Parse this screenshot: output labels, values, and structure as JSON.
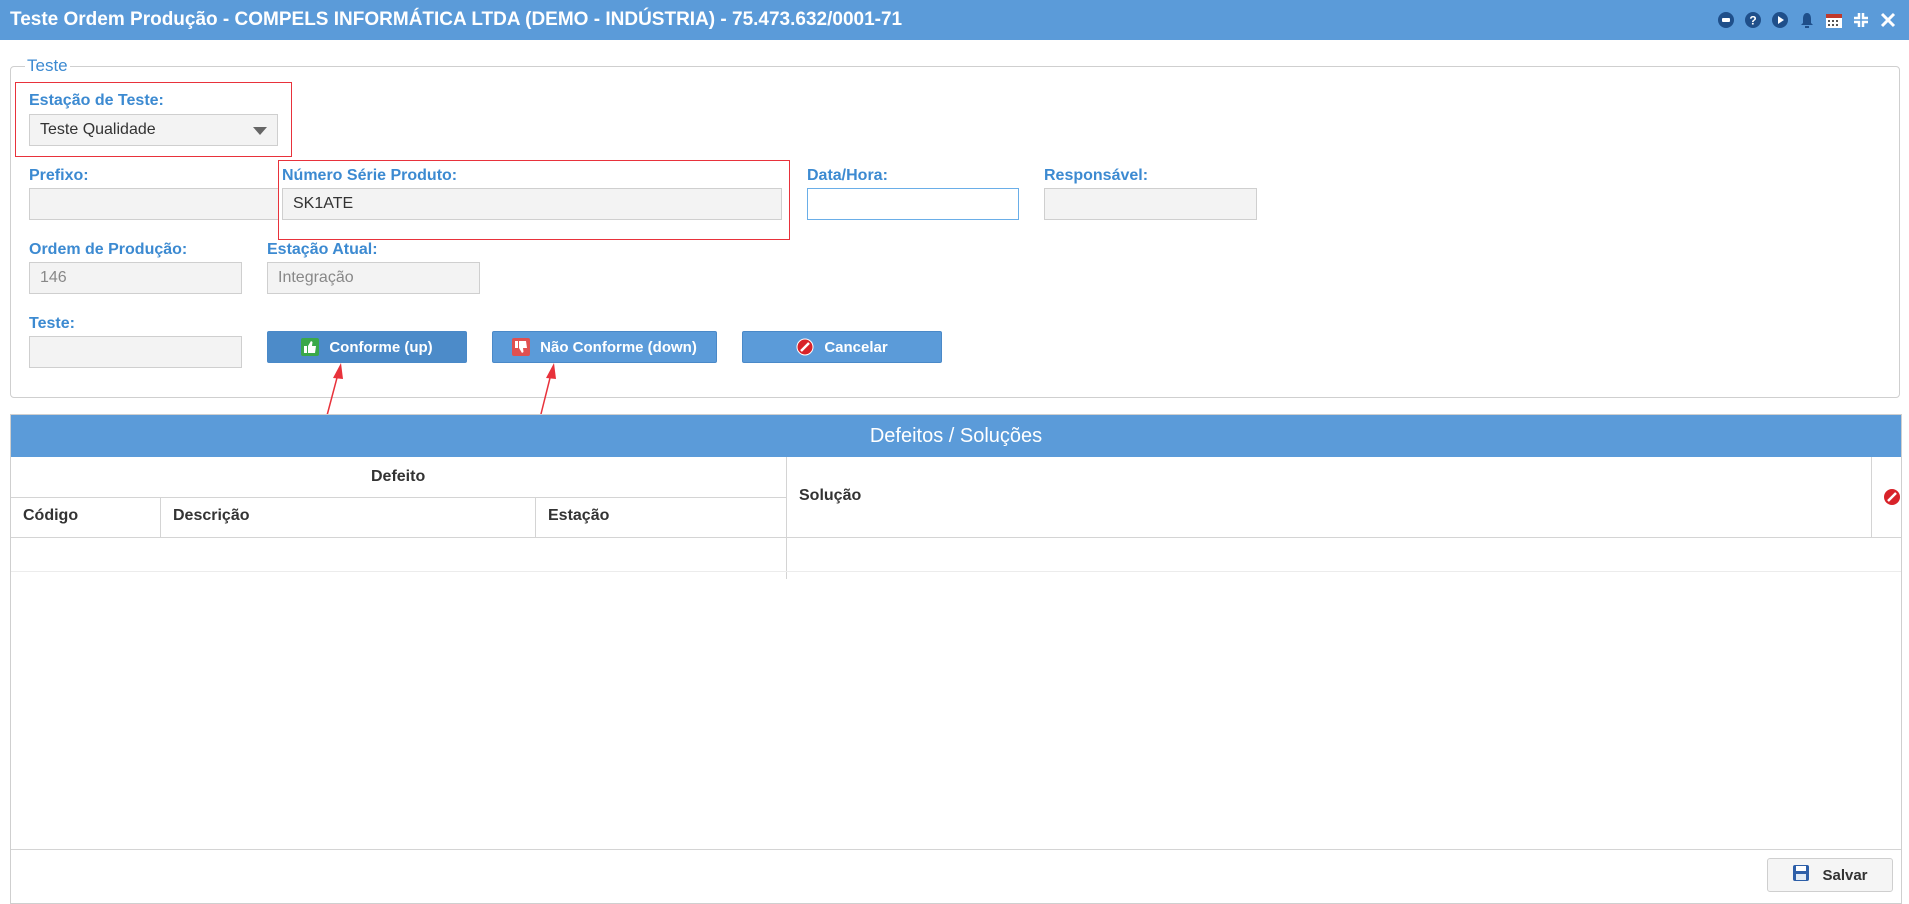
{
  "window": {
    "title": "Teste Ordem Produção - COMPELS INFORMÁTICA LTDA (DEMO - INDÚSTRIA) - 75.473.632/0001-71",
    "icons": [
      "record-icon",
      "help-icon",
      "play-icon",
      "bell-icon",
      "calendar-icon",
      "collapse-icon",
      "close-icon"
    ]
  },
  "form": {
    "legend": "Teste",
    "estacao_teste": {
      "label": "Estação de Teste:",
      "value": "Teste Qualidade"
    },
    "prefixo": {
      "label": "Prefixo:",
      "value": ""
    },
    "numero_serie": {
      "label": "Número Série Produto:",
      "value": "SK1ATE"
    },
    "data_hora": {
      "label": "Data/Hora:",
      "value": ""
    },
    "responsavel": {
      "label": "Responsável:",
      "value": ""
    },
    "ordem_producao": {
      "label": "Ordem de Produção:",
      "value": "146"
    },
    "estacao_atual": {
      "label": "Estação Atual:",
      "value": "Integração"
    },
    "teste": {
      "label": "Teste:",
      "value": ""
    },
    "buttons": {
      "conforme": "Conforme (up)",
      "nao_conforme": "Não Conforme (down)",
      "cancelar": "Cancelar"
    }
  },
  "grid": {
    "title": "Defeitos / Soluções",
    "group_defeito": "Defeito",
    "columns": {
      "codigo": "Código",
      "descricao": "Descrição",
      "estacao": "Estação",
      "solucao": "Solução"
    },
    "rows": []
  },
  "footer": {
    "salvar": "Salvar"
  },
  "colors": {
    "titlebar": "#5b9bd9",
    "label": "#3c8ad1",
    "highlight": "#e8323b"
  }
}
